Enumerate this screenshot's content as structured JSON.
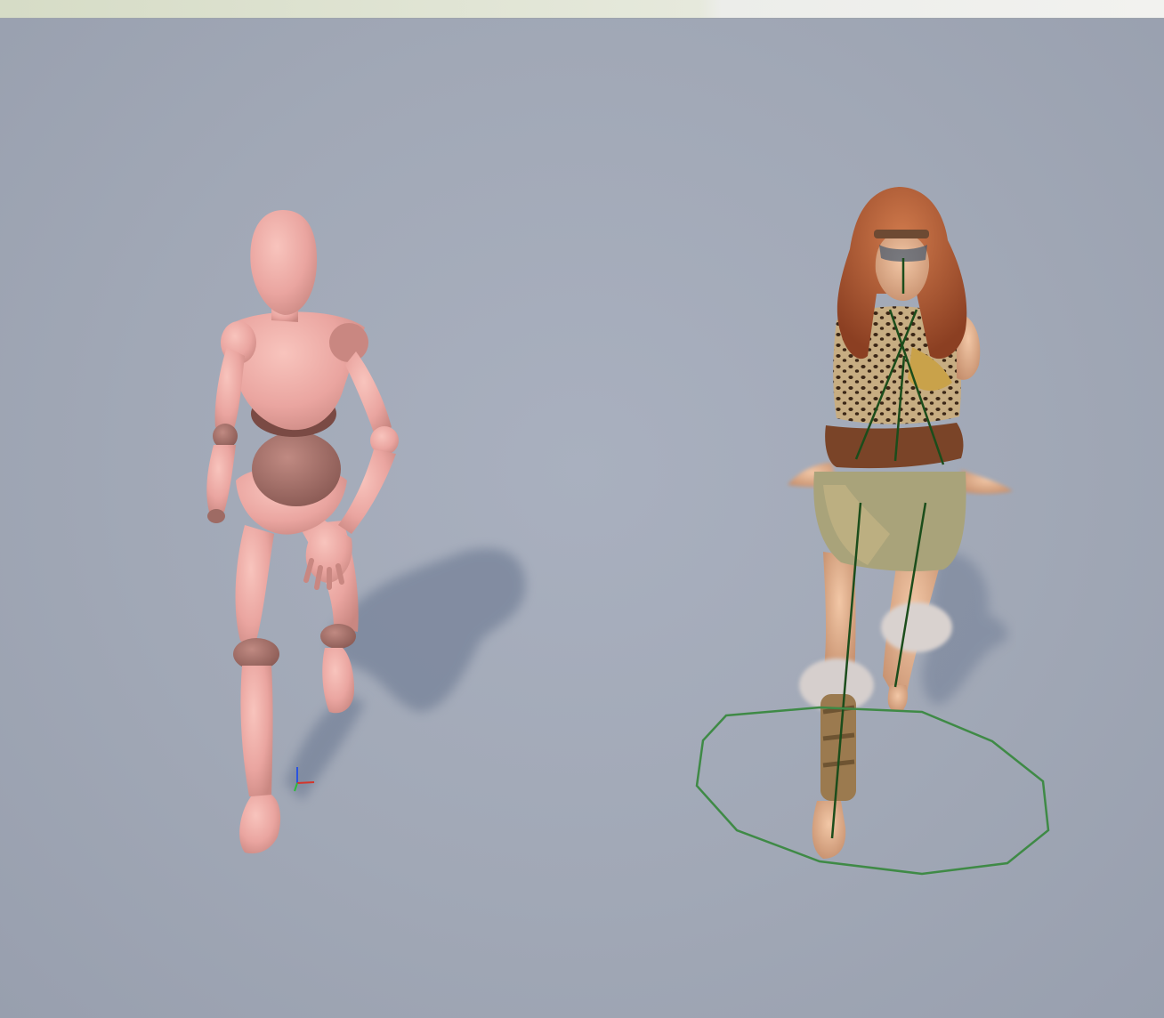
{
  "window": {
    "title": ""
  },
  "viewport": {
    "background": "#a3aab8",
    "mannequin_color": "#eaa5a0",
    "mannequin_joint_color": "#9e6b64",
    "debug_line_color": "#1b4d1b",
    "selection_ring_color": "#3f8a46",
    "gizmo_x_color": "#d4362b",
    "gizmo_y_color": "#2dbb3a",
    "gizmo_z_color": "#2b54e0"
  },
  "scene": {
    "actors": [
      {
        "name": "mannequin",
        "icon": "mannequin-figure"
      },
      {
        "name": "barbarian-character",
        "icon": "character-figure"
      }
    ],
    "gizmo": {
      "icon": "transform-axes-icon"
    }
  }
}
